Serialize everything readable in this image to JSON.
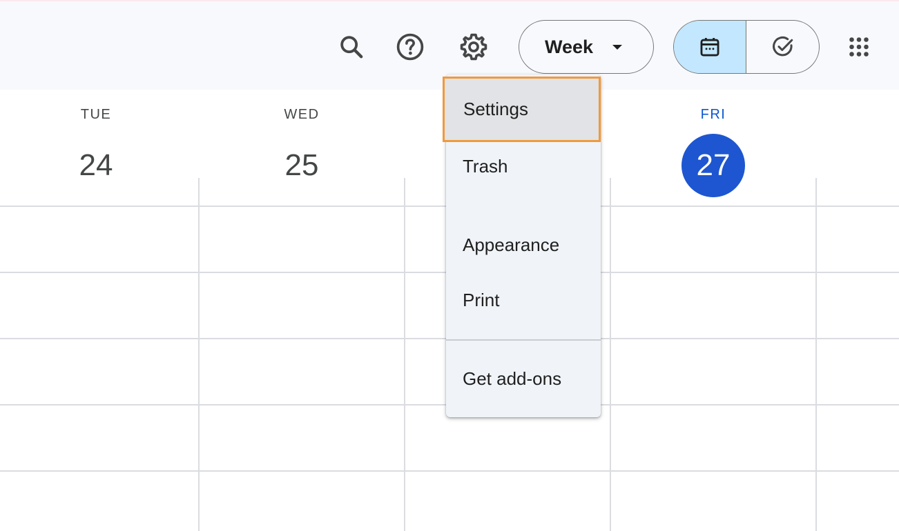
{
  "header": {
    "view_selector": {
      "selected": "Week"
    },
    "icons": [
      "search-icon",
      "help-icon",
      "settings-gear-icon",
      "calendar-icon",
      "tasks-check-icon",
      "apps-grid-icon"
    ]
  },
  "days": [
    {
      "name": "TUE",
      "number": "24",
      "today": false
    },
    {
      "name": "WED",
      "number": "25",
      "today": false
    },
    {
      "name": "FRI",
      "number": "27",
      "today": true
    }
  ],
  "settings_menu": {
    "items": [
      {
        "label": "Settings",
        "highlighted": true
      },
      {
        "label": "Trash"
      },
      {
        "label": "Appearance"
      },
      {
        "label": "Print"
      },
      {
        "label": "Get add-ons"
      }
    ]
  },
  "colors": {
    "accent": "#0b57d0",
    "today_circle": "#1d56d0",
    "highlight_border": "#f1993a",
    "segment_active": "#c2e7ff"
  }
}
